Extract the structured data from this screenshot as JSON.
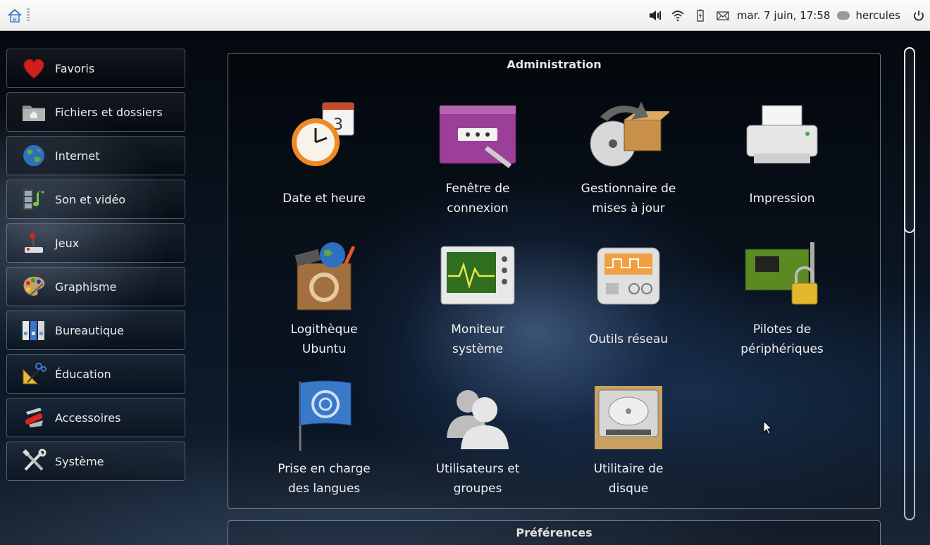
{
  "top_panel": {
    "home_icon": "home-icon",
    "tray_icons": [
      "volume-icon",
      "wifi-icon",
      "battery-icon",
      "mail-icon"
    ],
    "clock": "mar. 7 juin, 17:58",
    "user": "hercules",
    "power_icon": "power-icon"
  },
  "sidebar": {
    "items": [
      {
        "label": "Favoris",
        "icon": "heart-icon"
      },
      {
        "label": "Fichiers et dossiers",
        "icon": "folder-icon"
      },
      {
        "label": "Internet",
        "icon": "globe-icon"
      },
      {
        "label": "Son et vidéo",
        "icon": "music-video-icon"
      },
      {
        "label": "Jeux",
        "icon": "joystick-icon"
      },
      {
        "label": "Graphisme",
        "icon": "palette-icon"
      },
      {
        "label": "Bureautique",
        "icon": "office-binders-icon"
      },
      {
        "label": "Éducation",
        "icon": "education-tools-icon"
      },
      {
        "label": "Accessoires",
        "icon": "swiss-knife-icon"
      },
      {
        "label": "Système",
        "icon": "tools-icon"
      }
    ]
  },
  "main": {
    "group_title": "Administration",
    "apps": [
      {
        "label": "Date et heure",
        "icon": "clock-calendar-icon"
      },
      {
        "label": "Fenêtre de\nconnexion",
        "icon": "login-window-icon"
      },
      {
        "label": "Gestionnaire de\nmises à jour",
        "icon": "update-manager-icon"
      },
      {
        "label": "Impression",
        "icon": "printer-icon"
      },
      {
        "label": "Logithèque\nUbuntu",
        "icon": "software-center-icon"
      },
      {
        "label": "Moniteur\nsystème",
        "icon": "system-monitor-icon"
      },
      {
        "label": "Outils réseau",
        "icon": "network-tools-icon"
      },
      {
        "label": "Pilotes de\npériphériques",
        "icon": "device-drivers-icon"
      },
      {
        "label": "Prise en charge\ndes langues",
        "icon": "language-flag-icon"
      },
      {
        "label": "Utilisateurs et\ngroupes",
        "icon": "users-groups-icon"
      },
      {
        "label": "Utilitaire de\ndisque",
        "icon": "disk-utility-icon"
      }
    ],
    "next_group_title": "Préférences"
  }
}
